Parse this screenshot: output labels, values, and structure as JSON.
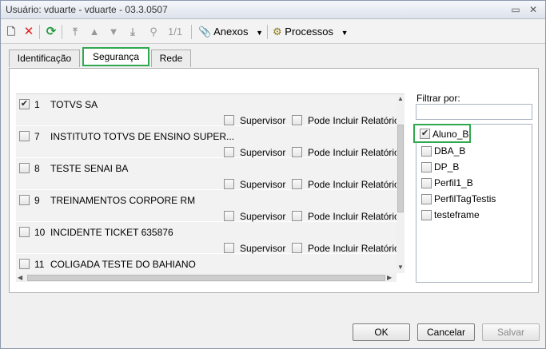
{
  "window": {
    "title": "Usuário: vduarte - vduarte - 03.3.0507"
  },
  "toolbar": {
    "record_position": "1/1",
    "anexos_label": "Anexos",
    "processos_label": "Processos"
  },
  "tabs": [
    {
      "label": "Identificação"
    },
    {
      "label": "Segurança"
    },
    {
      "label": "Rede"
    }
  ],
  "grid": {
    "rows": [
      {
        "num": "1",
        "name": "TOTVS SA",
        "checked": true,
        "supervisor": "Supervisor",
        "reports": "Pode Incluir Relatórios"
      },
      {
        "num": "7",
        "name": "INSTITUTO TOTVS DE ENSINO SUPER...",
        "checked": false,
        "supervisor": "Supervisor",
        "reports": "Pode Incluir Relatórios"
      },
      {
        "num": "8",
        "name": "TESTE SENAI BA",
        "checked": false,
        "supervisor": "Supervisor",
        "reports": "Pode Incluir Relatórios"
      },
      {
        "num": "9",
        "name": "TREINAMENTOS CORPORE RM",
        "checked": false,
        "supervisor": "Supervisor",
        "reports": "Pode Incluir Relatórios"
      },
      {
        "num": "10",
        "name": "INCIDENTE TICKET 635876",
        "checked": false,
        "supervisor": "Supervisor",
        "reports": "Pode Incluir Relatórios"
      },
      {
        "num": "11",
        "name": "COLIGADA TESTE DO BAHIANO",
        "checked": false,
        "supervisor": "",
        "reports": ""
      }
    ]
  },
  "filter": {
    "label": "Filtrar por:",
    "value": "",
    "items": [
      {
        "label": "Aluno_B",
        "checked": true
      },
      {
        "label": "DBA_B",
        "checked": false
      },
      {
        "label": "DP_B",
        "checked": false
      },
      {
        "label": "Perfil1_B",
        "checked": false
      },
      {
        "label": "PerfilTagTestis",
        "checked": false
      },
      {
        "label": "testeframe",
        "checked": false
      }
    ]
  },
  "buttons": {
    "ok": "OK",
    "cancel": "Cancelar",
    "save": "Salvar"
  },
  "colors": {
    "highlight": "#2fa84f",
    "delete": "#e02020",
    "refresh": "#1f9a3c"
  }
}
